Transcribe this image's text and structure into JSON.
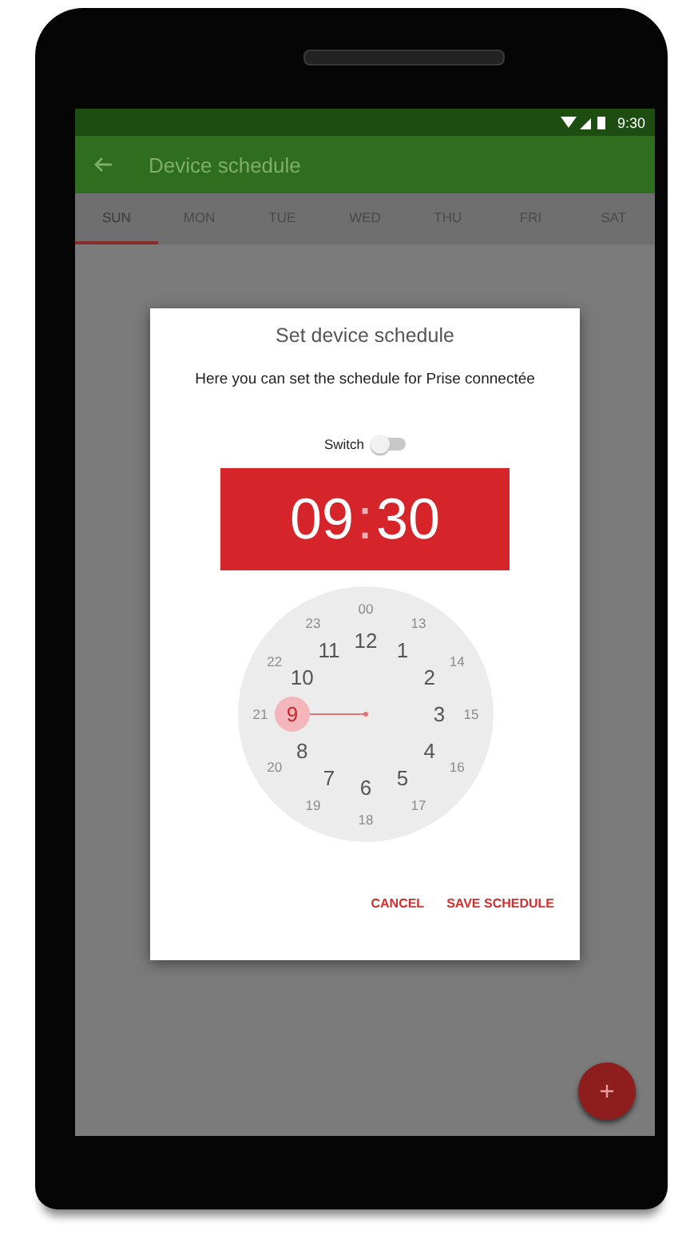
{
  "status_bar": {
    "time": "9:30"
  },
  "app_bar": {
    "title": "Device schedule"
  },
  "tabs": [
    {
      "label": "SUN",
      "selected": true
    },
    {
      "label": "MON",
      "selected": false
    },
    {
      "label": "TUE",
      "selected": false
    },
    {
      "label": "WED",
      "selected": false
    },
    {
      "label": "THU",
      "selected": false
    },
    {
      "label": "FRI",
      "selected": false
    },
    {
      "label": "SAT",
      "selected": false
    }
  ],
  "dialog": {
    "title": "Set device schedule",
    "message": "Here you can set the schedule for Prise connectée",
    "switch": {
      "label": "Switch",
      "on": false
    },
    "time": {
      "hours": "09",
      "separator": ":",
      "minutes": "30"
    },
    "clock": {
      "numbers": [
        {
          "label": "00",
          "selected": false
        },
        {
          "label": "23",
          "selected": false
        },
        {
          "label": "13",
          "selected": false
        },
        {
          "label": "12",
          "selected": false
        },
        {
          "label": "11",
          "selected": false
        },
        {
          "label": "1",
          "selected": false
        },
        {
          "label": "22",
          "selected": false
        },
        {
          "label": "14",
          "selected": false
        },
        {
          "label": "10",
          "selected": false
        },
        {
          "label": "2",
          "selected": false
        },
        {
          "label": "21",
          "selected": false
        },
        {
          "label": "9",
          "selected": true
        },
        {
          "label": "3",
          "selected": false
        },
        {
          "label": "15",
          "selected": false
        },
        {
          "label": "8",
          "selected": false
        },
        {
          "label": "4",
          "selected": false
        },
        {
          "label": "20",
          "selected": false
        },
        {
          "label": "16",
          "selected": false
        },
        {
          "label": "7",
          "selected": false
        },
        {
          "label": "5",
          "selected": false
        },
        {
          "label": "6",
          "selected": false
        },
        {
          "label": "19",
          "selected": false
        },
        {
          "label": "17",
          "selected": false
        },
        {
          "label": "18",
          "selected": false
        }
      ]
    },
    "buttons": [
      "CANCEL",
      "SAVE SCHEDULE"
    ]
  }
}
